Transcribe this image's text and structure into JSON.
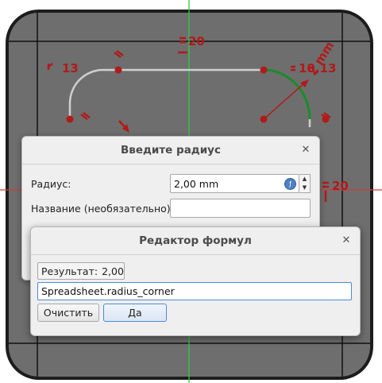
{
  "sketch": {
    "dim_top": "20",
    "dim_left": "13",
    "dim_right": "10,13",
    "dim_radius": "2 mm",
    "dim_side": "20"
  },
  "radius_dialog": {
    "title": "Введите радиус",
    "radius_label": "Радиус:",
    "radius_value": "2,00 mm",
    "name_label": "Название (необязательно)",
    "name_value": ""
  },
  "formula_dialog": {
    "title": "Редактор формул",
    "result_label": "Результат:",
    "result_value": "2,00",
    "expression_value": "Spreadsheet.radius_corner",
    "clear_label": "Очистить",
    "ok_label": "Да"
  },
  "icons": {
    "close": "close-icon",
    "formula": "formula-icon",
    "spin_up": "chevron-up-icon",
    "spin_down": "chevron-down-icon"
  },
  "colors": {
    "canvas_bg": "#6e6e6e",
    "constraint": "#b11a1a",
    "selected_arc": "#1a8c2a",
    "axis_vertical": "#2ecc40",
    "axis_horizontal": "#d33a3a"
  }
}
